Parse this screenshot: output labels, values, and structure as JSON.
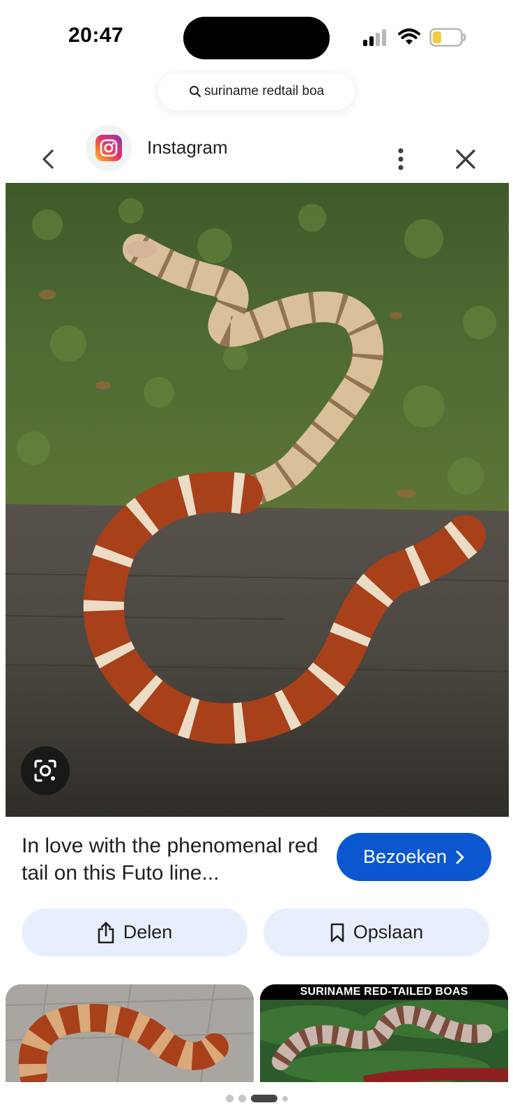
{
  "status_bar": {
    "time": "20:47"
  },
  "search": {
    "query": "suriname redtail boa"
  },
  "source": {
    "name": "Instagram"
  },
  "result": {
    "caption": "In love with the phenomenal red tail on this Futo line...",
    "visit_label": "Bezoeken",
    "share_label": "Delen",
    "save_label": "Opslaan"
  },
  "related": [
    {
      "title": ""
    },
    {
      "title": "SURINAME RED-TAILED BOAS"
    }
  ],
  "pager": {
    "count": 4,
    "active_index": 2
  },
  "colors": {
    "accent": "#0b57d0",
    "pill_bg": "#e8effc"
  },
  "icons": [
    "search-icon",
    "back-icon",
    "instagram-icon",
    "more-vert-icon",
    "close-icon",
    "lens-icon",
    "share-icon",
    "bookmark-icon",
    "chevron-right-icon"
  ]
}
